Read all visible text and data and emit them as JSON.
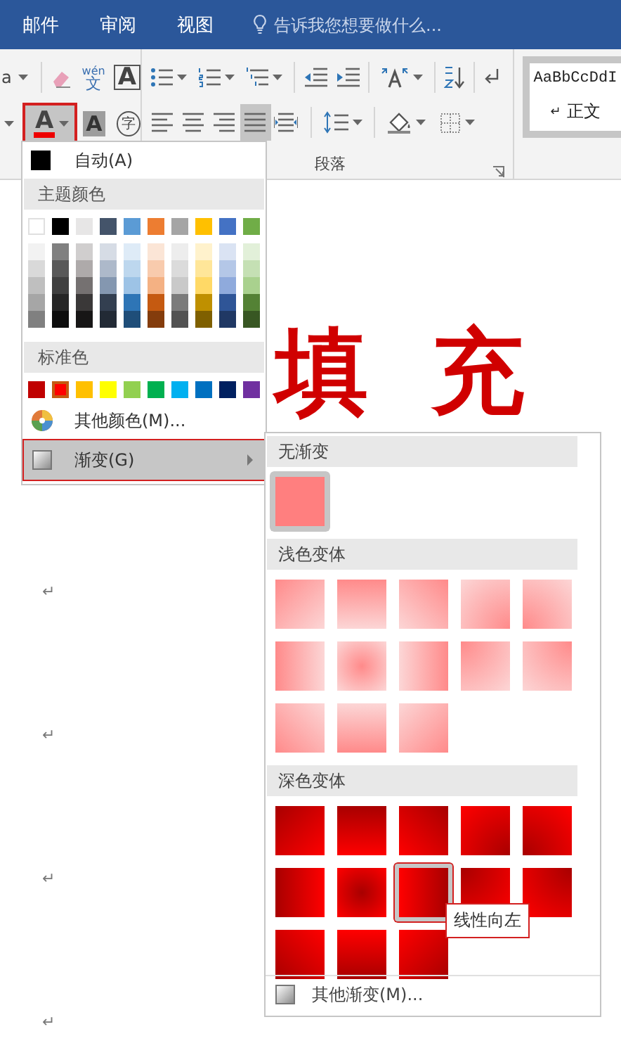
{
  "tabs": [
    {
      "label": "邮件",
      "selected": false
    },
    {
      "label": "审阅",
      "selected": false
    },
    {
      "label": "视图",
      "selected": false
    }
  ],
  "tell_me": {
    "placeholder": "告诉我您想要做什么..."
  },
  "ribbon": {
    "font_partial": "a",
    "phonetic_top": "wén",
    "phonetic_bottom": "文",
    "char_border": "A",
    "font_color": {
      "label": "A",
      "pressed": true,
      "annotated": true
    },
    "char_shading": "A",
    "enclose_char": "字",
    "alignment": [
      {
        "kind": "left",
        "pressed": false
      },
      {
        "kind": "center",
        "pressed": false
      },
      {
        "kind": "right",
        "pressed": false
      },
      {
        "kind": "justify",
        "pressed": true
      },
      {
        "kind": "distributed",
        "pressed": false
      }
    ],
    "group_label": "段落",
    "style_preview": {
      "sample": "AaBbCcDdI",
      "mark": "↵",
      "name": "正文"
    }
  },
  "document": {
    "heading": "填 充",
    "paragraph_marks": [
      "↵",
      "↵",
      "↵",
      "↵"
    ]
  },
  "color_menu": {
    "automatic": "自动(A)",
    "theme_title": "主题颜色",
    "theme_colors": [
      {
        "color": "#ffffff",
        "shades": [
          {
            "color": "#f2f2f2"
          },
          {
            "color": "#d9d9d9"
          },
          {
            "color": "#bfbfbf"
          },
          {
            "color": "#a6a6a6"
          },
          {
            "color": "#808080"
          }
        ]
      },
      {
        "color": "#000000",
        "shades": [
          {
            "color": "#808080"
          },
          {
            "color": "#595959"
          },
          {
            "color": "#404040"
          },
          {
            "color": "#262626"
          },
          {
            "color": "#0d0d0d"
          }
        ]
      },
      {
        "color": "#e7e6e6",
        "shades": [
          {
            "color": "#d0cece"
          },
          {
            "color": "#aeaaaa"
          },
          {
            "color": "#757171"
          },
          {
            "color": "#3a3838"
          },
          {
            "color": "#171616"
          }
        ]
      },
      {
        "color": "#44546a",
        "shades": [
          {
            "color": "#d6dce5"
          },
          {
            "color": "#adb9ca"
          },
          {
            "color": "#8497b0"
          },
          {
            "color": "#333f50"
          },
          {
            "color": "#222a35"
          }
        ]
      },
      {
        "color": "#5b9bd5",
        "shades": [
          {
            "color": "#deebf7"
          },
          {
            "color": "#bdd7ee"
          },
          {
            "color": "#9dc3e6"
          },
          {
            "color": "#2e75b6"
          },
          {
            "color": "#1f4e79"
          }
        ]
      },
      {
        "color": "#ed7d31",
        "shades": [
          {
            "color": "#fbe5d6"
          },
          {
            "color": "#f8cbad"
          },
          {
            "color": "#f4b183"
          },
          {
            "color": "#c55a11"
          },
          {
            "color": "#843c0c"
          }
        ]
      },
      {
        "color": "#a5a5a5",
        "shades": [
          {
            "color": "#ededed"
          },
          {
            "color": "#dbdbdb"
          },
          {
            "color": "#c9c9c9"
          },
          {
            "color": "#7b7b7b"
          },
          {
            "color": "#525252"
          }
        ]
      },
      {
        "color": "#ffc000",
        "shades": [
          {
            "color": "#fff2cc"
          },
          {
            "color": "#ffe699"
          },
          {
            "color": "#ffd966"
          },
          {
            "color": "#bf9000"
          },
          {
            "color": "#7f6000"
          }
        ]
      },
      {
        "color": "#4472c4",
        "shades": [
          {
            "color": "#dae3f3"
          },
          {
            "color": "#b4c7e7"
          },
          {
            "color": "#8faadc"
          },
          {
            "color": "#2f5597"
          },
          {
            "color": "#203864"
          }
        ]
      },
      {
        "color": "#70ad47",
        "shades": [
          {
            "color": "#e2f0d9"
          },
          {
            "color": "#c5e0b4"
          },
          {
            "color": "#a9d18e"
          },
          {
            "color": "#548235"
          },
          {
            "color": "#385723"
          }
        ]
      }
    ],
    "standard_title": "标准色",
    "standard_colors": [
      {
        "color": "#c00000",
        "selected": false
      },
      {
        "color": "#ff0000",
        "selected": true
      },
      {
        "color": "#ffc000",
        "selected": false
      },
      {
        "color": "#ffff00",
        "selected": false
      },
      {
        "color": "#92d050",
        "selected": false
      },
      {
        "color": "#00b050",
        "selected": false
      },
      {
        "color": "#00b0f0",
        "selected": false
      },
      {
        "color": "#0070c0",
        "selected": false
      },
      {
        "color": "#002060",
        "selected": false
      },
      {
        "color": "#7030a0",
        "selected": false
      }
    ],
    "more_colors": "其他颜色(M)...",
    "gradient": {
      "label": "渐变(G)",
      "selected": true,
      "annotated": true
    }
  },
  "gradient_menu": {
    "sections": [
      {
        "title": "无渐变",
        "kind": "none",
        "tiles": [
          {
            "kind": "flat",
            "selected": true,
            "annotated": false
          }
        ]
      },
      {
        "title": "浅色变体",
        "kind": "light",
        "tiles": [
          {
            "kind": "diag-tl",
            "selected": false,
            "annotated": false
          },
          {
            "kind": "down",
            "selected": false,
            "annotated": false
          },
          {
            "kind": "diag-tr",
            "selected": false,
            "annotated": false
          },
          {
            "kind": "corner-br",
            "selected": false,
            "annotated": false
          },
          {
            "kind": "corner-bl",
            "selected": false,
            "annotated": false
          },
          {
            "kind": "right",
            "selected": false,
            "annotated": false
          },
          {
            "kind": "center",
            "selected": false,
            "annotated": false
          },
          {
            "kind": "left",
            "selected": false,
            "annotated": false
          },
          {
            "kind": "corner-tl",
            "selected": false,
            "annotated": false
          },
          {
            "kind": "corner-tr",
            "selected": false,
            "annotated": false
          },
          {
            "kind": "diag-bl",
            "selected": false,
            "annotated": false
          },
          {
            "kind": "up",
            "selected": false,
            "annotated": false
          },
          {
            "kind": "diag-br",
            "selected": false,
            "annotated": false
          }
        ]
      },
      {
        "title": "深色变体",
        "kind": "dark",
        "tiles": [
          {
            "kind": "diag-tl",
            "selected": false,
            "annotated": false
          },
          {
            "kind": "down",
            "selected": false,
            "annotated": false
          },
          {
            "kind": "diag-tr",
            "selected": false,
            "annotated": false
          },
          {
            "kind": "corner-br",
            "selected": false,
            "annotated": false
          },
          {
            "kind": "corner-bl",
            "selected": false,
            "annotated": false
          },
          {
            "kind": "right",
            "selected": false,
            "annotated": false
          },
          {
            "kind": "center",
            "selected": false,
            "annotated": false
          },
          {
            "kind": "left",
            "selected": true,
            "annotated": true
          },
          {
            "kind": "corner-tl",
            "selected": false,
            "annotated": false
          },
          {
            "kind": "corner-tr",
            "selected": false,
            "annotated": false
          },
          {
            "kind": "diag-bl",
            "selected": false,
            "annotated": false
          },
          {
            "kind": "up",
            "selected": false,
            "annotated": false
          },
          {
            "kind": "diag-br",
            "selected": false,
            "annotated": false
          }
        ]
      }
    ],
    "tooltip": {
      "text": "线性向左",
      "annotated": true
    },
    "more_gradients": "其他渐变(M)..."
  }
}
